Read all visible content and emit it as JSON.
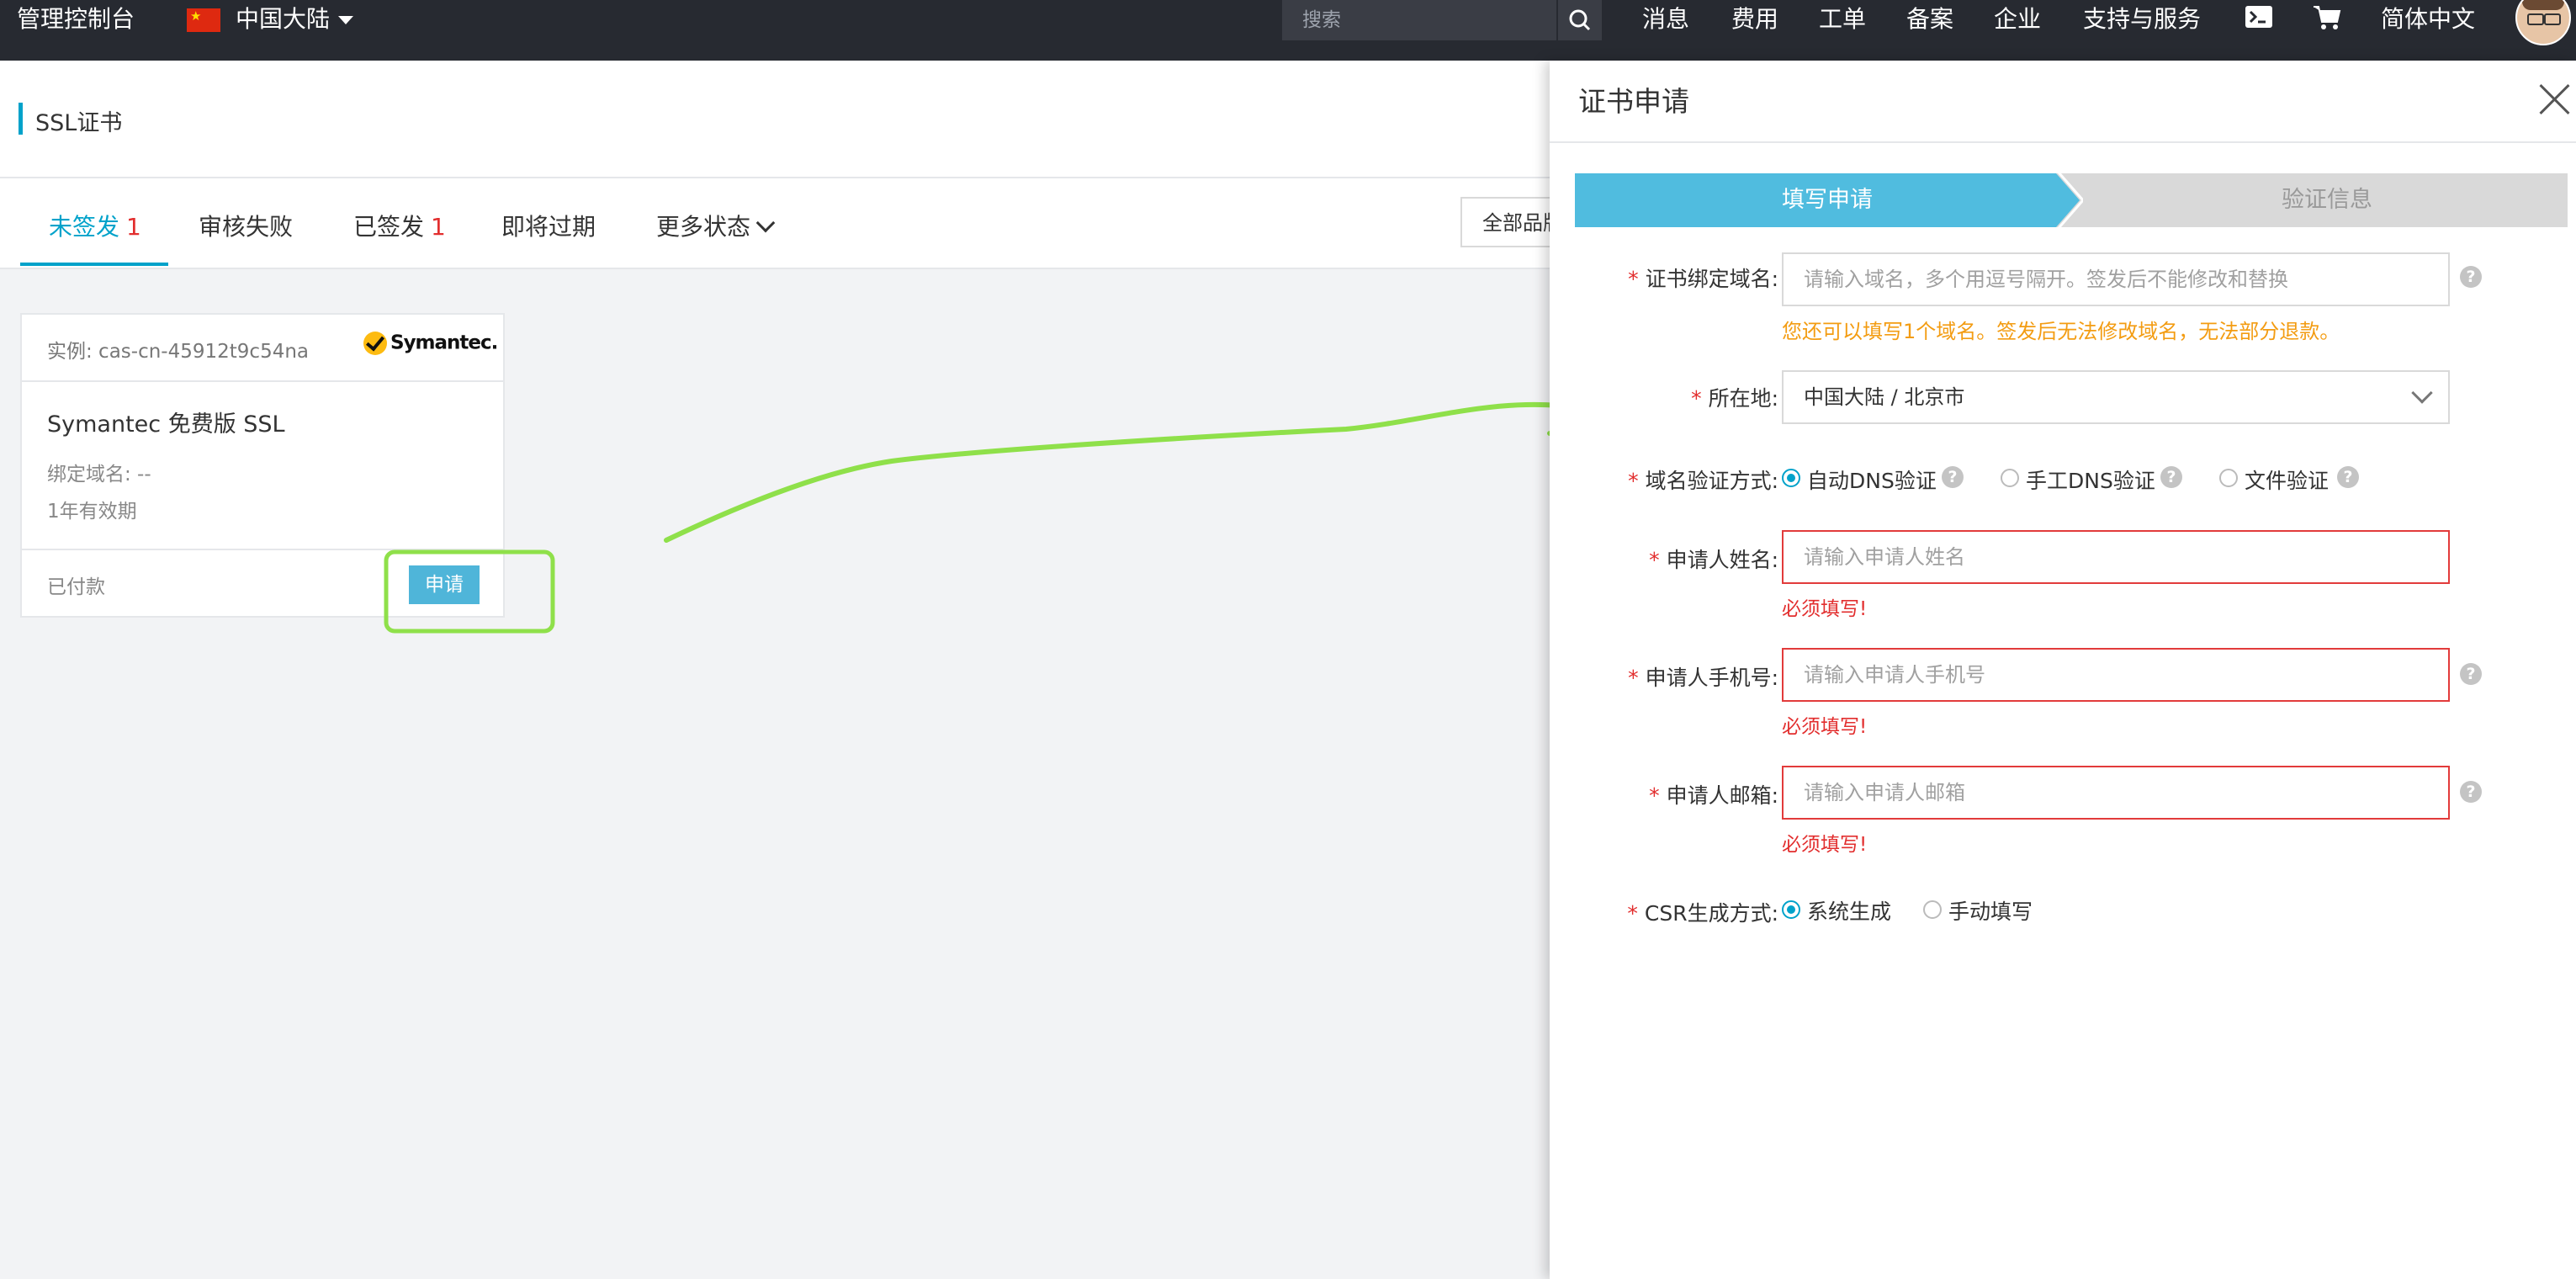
{
  "topbar": {
    "console_label": "管理控制台",
    "region_label": "中国大陆",
    "search_placeholder": "搜索",
    "nav": [
      "消息",
      "费用",
      "工单",
      "备案",
      "企业",
      "支持与服务"
    ],
    "language_label": "简体中文",
    "icons": [
      "china-flag-icon",
      "caret-down-icon",
      "search-icon",
      "terminal-icon",
      "cart-icon",
      "avatar"
    ]
  },
  "page": {
    "title": "SSL证书",
    "accent_color": "#00a2ca",
    "tabs": [
      {
        "label": "未签发",
        "count": "1"
      },
      {
        "label": "审核失败",
        "count": ""
      },
      {
        "label": "已签发",
        "count": "1"
      },
      {
        "label": "即将过期",
        "count": ""
      },
      {
        "label": "更多状态",
        "count": ""
      }
    ],
    "filter_label": "全部品牌"
  },
  "card": {
    "instance": "实例: cas-cn-45912t9c54na",
    "brand": "Symantec.",
    "product": "Symantec 免费版 SSL",
    "bind_domain": "绑定域名: --",
    "validity": "1年有效期",
    "status": "已付款",
    "apply_label": "申请"
  },
  "drawer": {
    "title": "证书申请",
    "steps": [
      "填写申请",
      "验证信息"
    ],
    "required_mark": "*",
    "domain": {
      "label": "证书绑定域名:",
      "placeholder": "请输入域名，多个用逗号隔开。签发后不能修改和替换",
      "hint": "您还可以填写1个域名。签发后无法修改域名，无法部分退款。"
    },
    "location": {
      "label": "所在地:",
      "value": "中国大陆 / 北京市"
    },
    "verify": {
      "label": "域名验证方式:",
      "options": [
        "自动DNS验证",
        "手工DNS验证",
        "文件验证"
      ],
      "selected": 0
    },
    "name": {
      "label": "申请人姓名:",
      "placeholder": "请输入申请人姓名",
      "error": "必须填写!"
    },
    "phone": {
      "label": "申请人手机号:",
      "placeholder": "请输入申请人手机号",
      "error": "必须填写!"
    },
    "email": {
      "label": "申请人邮箱:",
      "placeholder": "请输入申请人邮箱",
      "error": "必须填写!"
    },
    "csr": {
      "label": "CSR生成方式:",
      "options": [
        "系统生成",
        "手动填写"
      ],
      "selected": 0
    }
  },
  "colors": {
    "topbar": "#272a31",
    "accent": "#00a2ca",
    "step_active": "#50bcdf",
    "error": "#e22e2e",
    "hint": "#f39c12",
    "annotation": "#8fe04a"
  }
}
